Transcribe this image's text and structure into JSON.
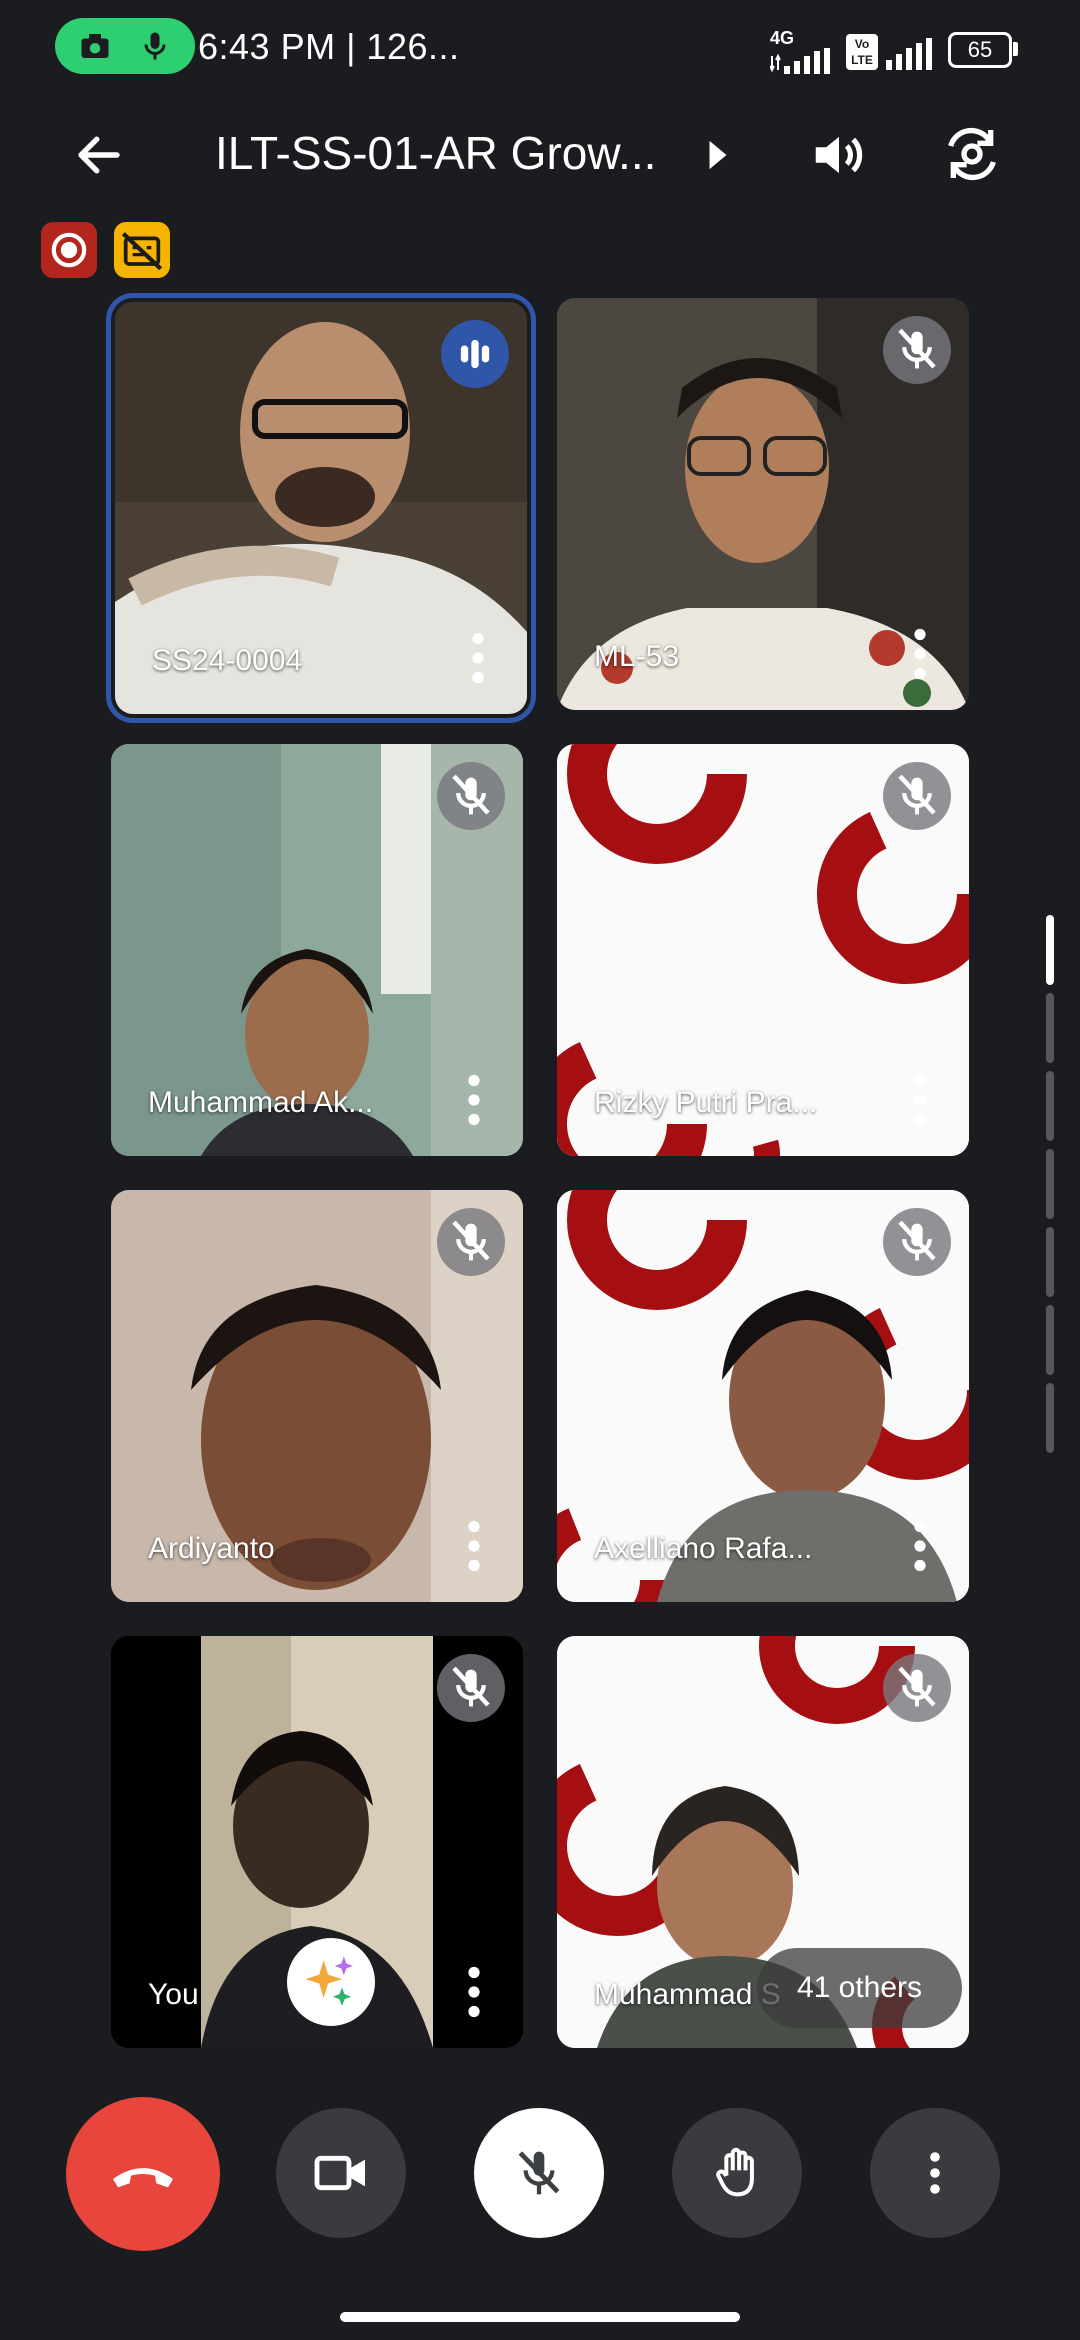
{
  "status_bar": {
    "time": "6:43 PM | 126...",
    "network": "4G",
    "volte": "Vo LTE",
    "battery": "65"
  },
  "meeting": {
    "title": "ILT-SS-01-AR Grow..."
  },
  "participants": [
    {
      "name": "SS24-0004",
      "muted": false,
      "speaking": true
    },
    {
      "name": "ML-53",
      "muted": true
    },
    {
      "name": "Muhammad Ak...",
      "muted": true
    },
    {
      "name": "Rizky Putri Pra...",
      "muted": true
    },
    {
      "name": "Ardiyanto",
      "muted": true
    },
    {
      "name": "Axelliano Rafa...",
      "muted": true
    },
    {
      "name": "You",
      "muted": true
    },
    {
      "name": "Muhammad S",
      "muted": true
    }
  ],
  "others_chip": "41 others",
  "colors": {
    "end_call": "#e8453c",
    "speaking_border": "#2f56a8",
    "background": "#1b1c20",
    "recording_badge": "#b3261e",
    "caption_badge": "#f5b400"
  }
}
